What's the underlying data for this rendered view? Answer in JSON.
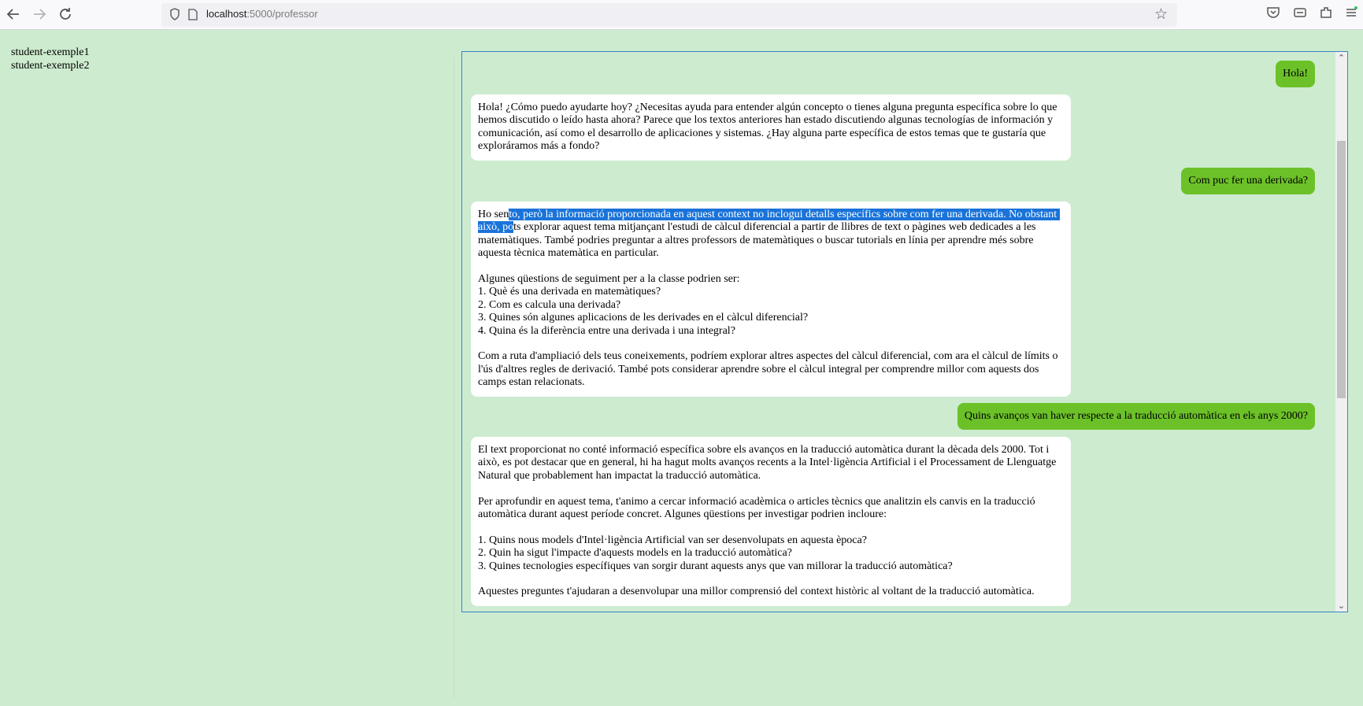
{
  "browser": {
    "url_host": "localhost",
    "url_rest": ":5000/professor"
  },
  "sidebar": {
    "students": [
      "student-exemple1",
      "student-exemple2"
    ]
  },
  "chat": {
    "messages": [
      {
        "role": "user",
        "text": "Hola!"
      },
      {
        "role": "bot",
        "text": "Hola! ¿Cómo puedo ayudarte hoy? ¿Necesitas ayuda para entender algún concepto o tienes alguna pregunta específica sobre lo que hemos discutido o leído hasta ahora? Parece que los textos anteriores han estado discutiendo algunas tecnologías de información y comunicación, así como el desarrollo de aplicaciones y sistemas. ¿Hay alguna parte específica de estos temas que te gustaría que exploráramos más a fondo?"
      },
      {
        "role": "user",
        "text": "Com puc fer una derivada?"
      },
      {
        "role": "bot",
        "text_before_selection": "Ho sen",
        "selected_text": "to, però la informació proporcionada en aquest context no inclogui detalls específics sobre com fer una derivada. No obstant això, po",
        "text_after_selection": "ts explorar aquest tema mitjançant l'estudi de càlcul diferencial a partir de llibres de text o pàgines web dedicades a les matemàtiques. També podries preguntar a altres professors de matemàtiques o buscar tutorials en línia per aprendre més sobre aquesta tècnica matemàtica en particular.\n\nAlgunes qüestions de seguiment per a la classe podrien ser:\n1. Què és una derivada en matemàtiques?\n2. Com es calcula una derivada?\n3. Quines són algunes aplicacions de les derivades en el càlcul diferencial?\n4. Quina és la diferència entre una derivada i una integral?\n\nCom a ruta d'ampliació dels teus coneixements, podríem explorar altres aspectes del càlcul diferencial, com ara el càlcul de límits o l'ús d'altres regles de derivació. També pots considerar aprendre sobre el càlcul integral per comprendre millor com aquests dos camps estan relacionats."
      },
      {
        "role": "user",
        "text": "Quins avanços van haver respecte a la traducció automàtica en els anys 2000?"
      },
      {
        "role": "bot",
        "text": "El text proporcionat no conté informació específica sobre els avanços en la traducció automàtica durant la dècada dels 2000. Tot i això, es pot destacar que en general, hi ha hagut molts avanços recents a la Intel·ligència Artificial i el Processament de Llenguatge Natural que probablement han impactat la traducció automàtica.\n\nPer aprofundir en aquest tema, t'animo a cercar informació acadèmica o articles tècnics que analitzin els canvis en la traducció automàtica durant aquest període concret. Algunes qüestions per investigar podrien incloure:\n\n1. Quins nous models d'Intel·ligència Artificial van ser desenvolupats en aquesta època?\n2. Quin ha sigut l'impacte d'aquests models en la traducció automàtica?\n3. Quines tecnologies específiques van sorgir durant aquests anys que van millorar la traducció automàtica?\n\nAquestes preguntes t'ajudaran a desenvolupar una millor comprensió del context històric al voltant de la traducció automàtica."
      }
    ]
  },
  "icons": [
    "back-icon",
    "forward-icon",
    "reload-icon",
    "shield-icon",
    "page-icon",
    "bookmark-star-icon",
    "pocket-icon",
    "extension-icon",
    "puzzle-icon",
    "menu-icon",
    "scroll-up-icon",
    "scroll-down-icon"
  ]
}
